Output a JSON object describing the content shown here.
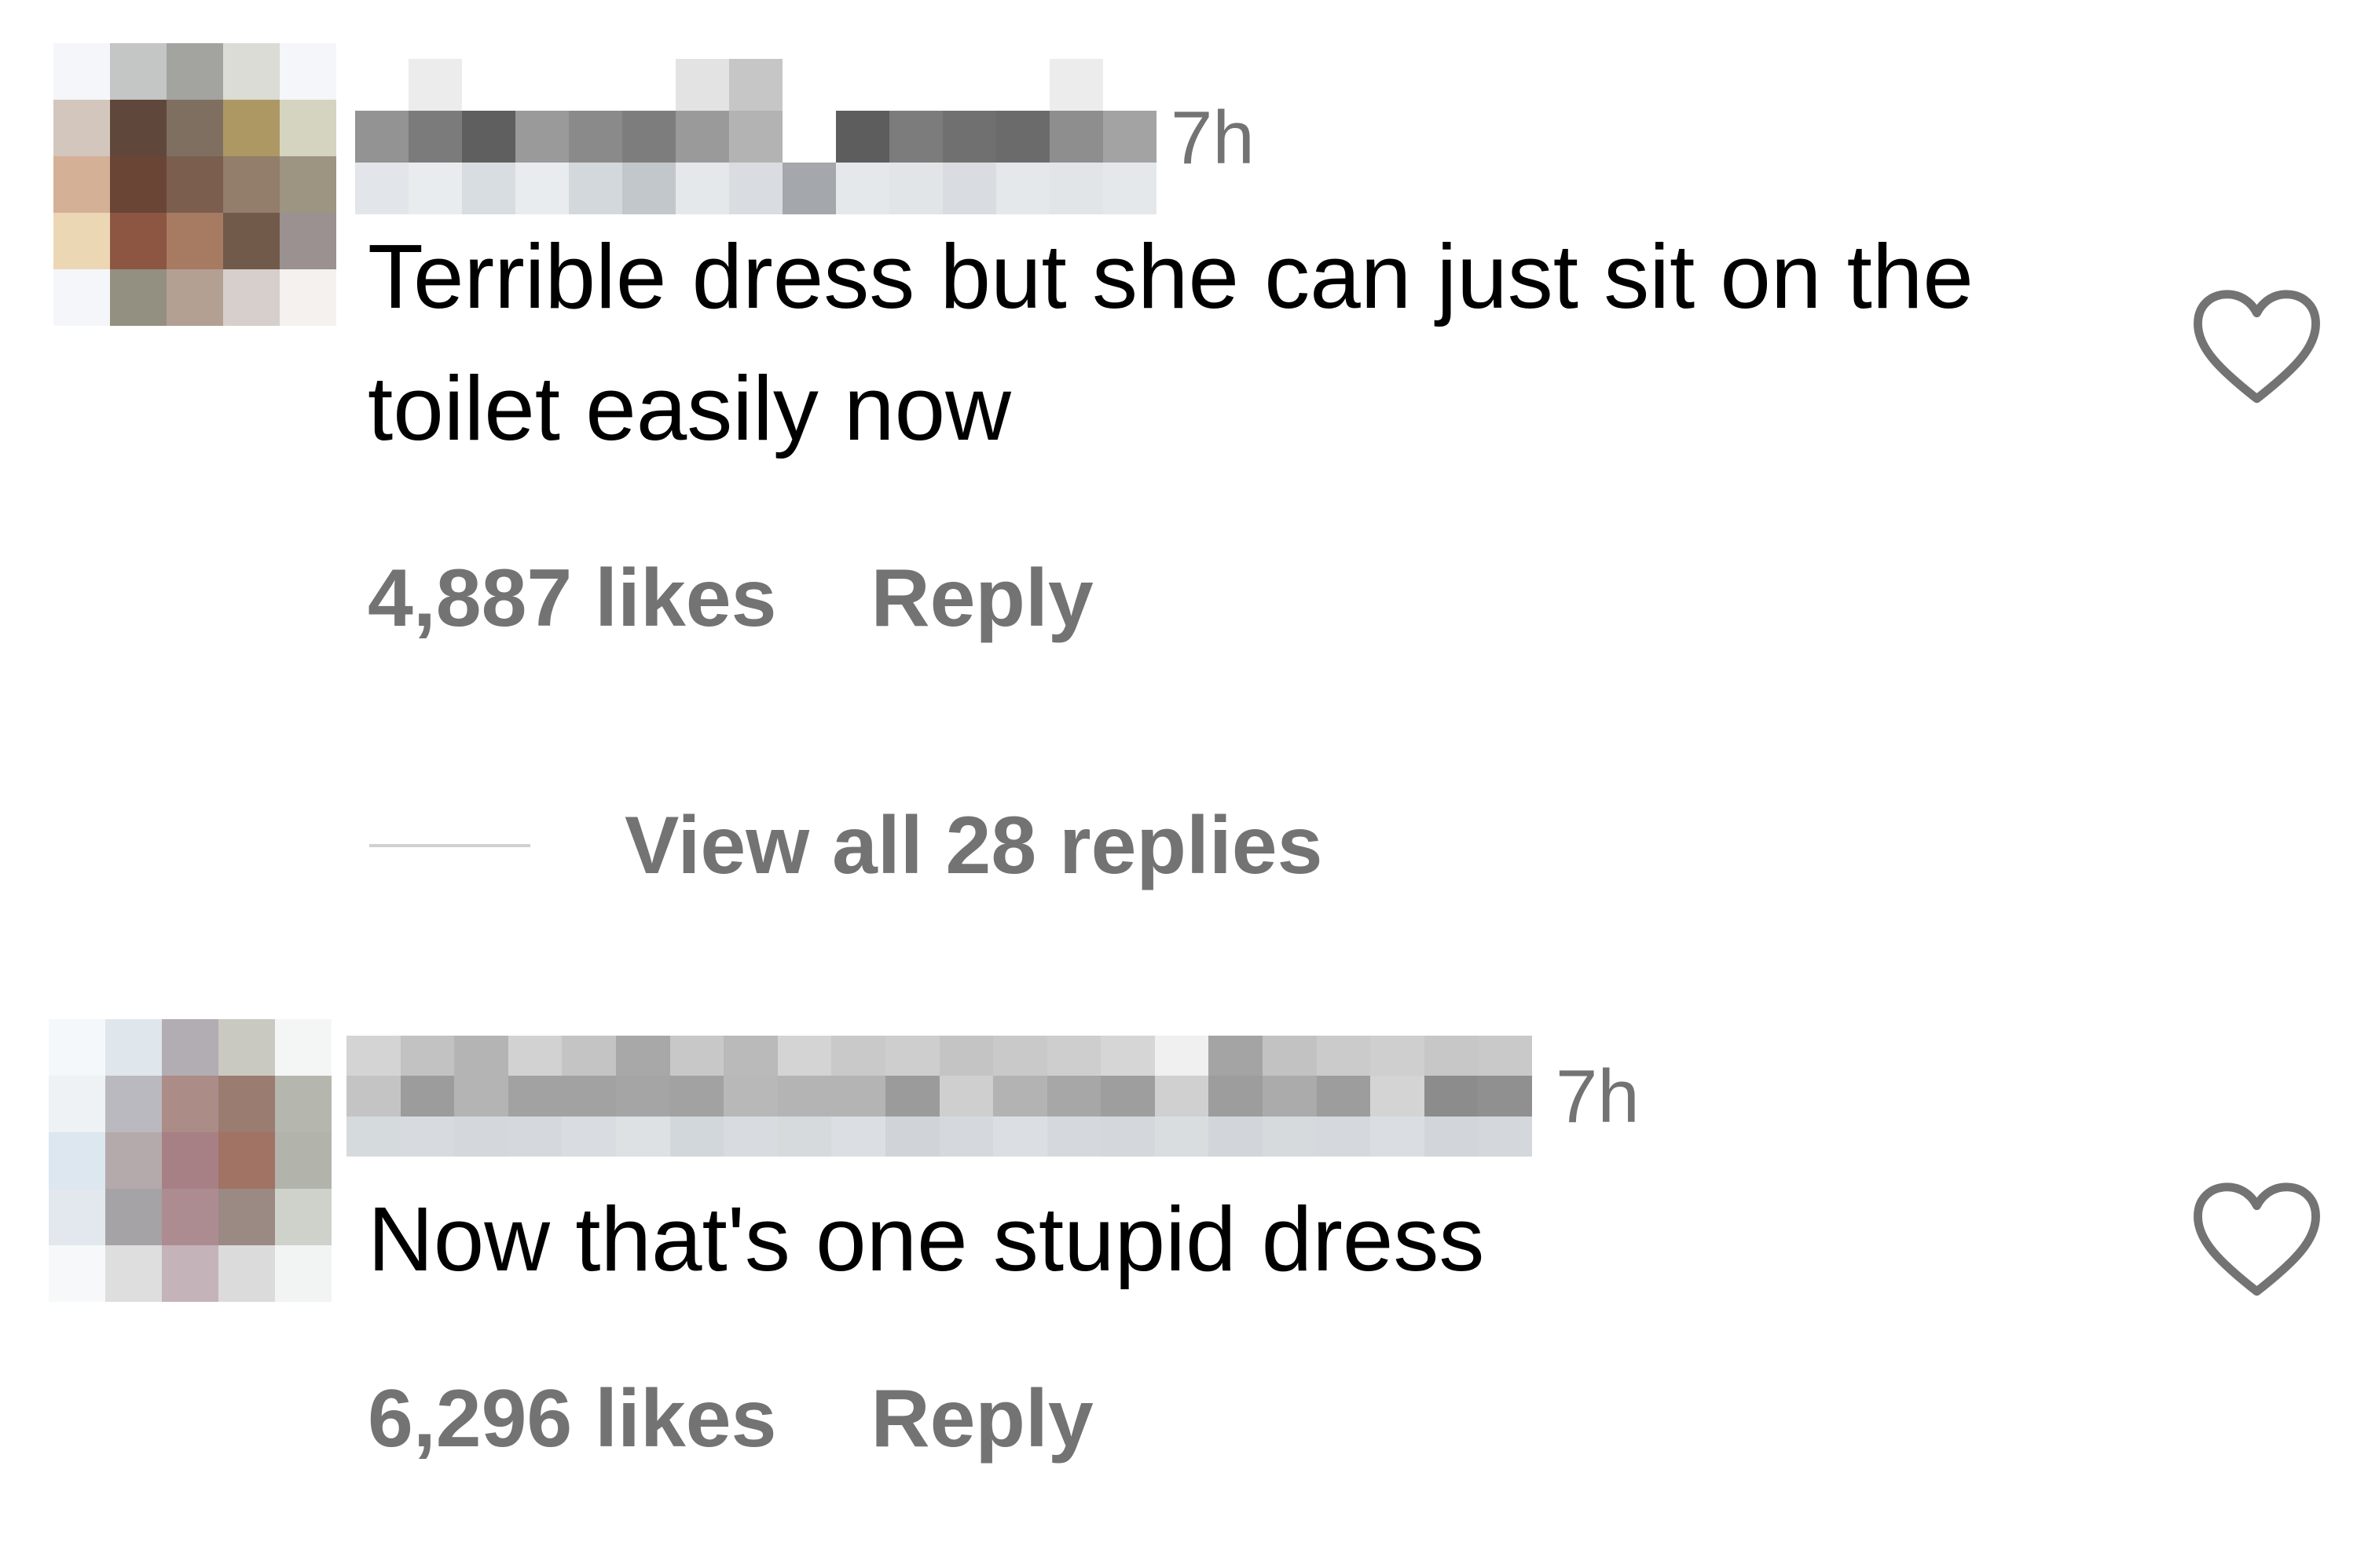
{
  "comments": [
    {
      "username_pixelated": true,
      "time": "7h",
      "text": "Terrible dress but she can just sit on the toilet easily now",
      "likes": "4,887 likes",
      "reply_label": "Reply",
      "liked": false,
      "avatar_colors": [
        "#f4f6fa",
        "#c4c5c5",
        "#a3a39f",
        "#dbdcd6",
        "#f4f6fa",
        "#d3c6bc",
        "#60473b",
        "#7f6f60",
        "#ad9863",
        "#d5d4c0",
        "#d4b097",
        "#6a4535",
        "#7b5e4e",
        "#927e6b",
        "#9d9481",
        "#ecd7b5",
        "#8c5642",
        "#a77a62",
        "#725a4b",
        "#9a9190",
        "#f5f6f9",
        "#939082",
        "#b3a092",
        "#d7cfcc",
        "#f4f1ee"
      ],
      "username_colors": [
        "#ffffff",
        "#ececec",
        "#ffffff",
        "#ffffff",
        "#ffffff",
        "#ffffff",
        "#e3e3e3",
        "#c6c6c6",
        "#ffffff",
        "#ffffff",
        "#ffffff",
        "#ffffff",
        "#ffffff",
        "#ececec",
        "#ffffff",
        "#939393",
        "#7b7b7b",
        "#5f5f5f",
        "#9a9a9a",
        "#8a8a8a",
        "#7d7d7d",
        "#9a9a9a",
        "#b3b3b3",
        "#ffffff",
        "#5d5d5d",
        "#7c7c7c",
        "#707070",
        "#6b6b6b",
        "#8e8e8e",
        "#a3a3a3",
        "#e2e6ea",
        "#e8ecef",
        "#d8dde1",
        "#e9ecef",
        "#d3d8dc",
        "#c2c7cb",
        "#e4e8eb",
        "#d9dde1",
        "#a4a8ac",
        "#e4e8eb",
        "#e1e5e8",
        "#d9dde1",
        "#e5e8eb",
        "#e1e5e8",
        "#e4e8eb"
      ]
    },
    {
      "username_pixelated": true,
      "time": "7h",
      "text": "Now that's one stupid dress",
      "likes": "6,296 likes",
      "reply_label": "Reply",
      "liked": false,
      "avatar_colors": [
        "#f4f8fa",
        "#dfe6ec",
        "#b1adb2",
        "#c9c9c1",
        "#f4f6f6",
        "#eef2f5",
        "#bbb9c0",
        "#ab8c87",
        "#9a7c70",
        "#b5b7ae",
        "#dce7ef",
        "#b5aaab",
        "#a78085",
        "#a07365",
        "#b2b3aa",
        "#e2e8ee",
        "#a6a3a6",
        "#ad8c91",
        "#9b8983",
        "#cfd2cb",
        "#f6f8fa",
        "#dedede",
        "#c4b3b8",
        "#dcdbdc",
        "#f2f4f4"
      ],
      "username_colors": [
        "#d4d4d4",
        "#c2c2c2",
        "#b4b4b4",
        "#d2d2d2",
        "#c4c4c4",
        "#a8a8a8",
        "#c8c8c8",
        "#bababa",
        "#d4d4d4",
        "#c9c9c9",
        "#cecece",
        "#c4c4c4",
        "#c9c9c9",
        "#cecece",
        "#d6d6d6",
        "#f0f0f0",
        "#a4a4a4",
        "#c2c2c2",
        "#cbcbcb",
        "#cfcfcf",
        "#c7c7c7",
        "#c9c9c9",
        "#c4c4c4",
        "#9c9c9c",
        "#b4b4b4",
        "#a2a2a2",
        "#a2a2a2",
        "#a5a5a5",
        "#a2a2a2",
        "#b8b8b8",
        "#b4b4b4",
        "#b4b4b4",
        "#9b9b9b",
        "#cfcfcf",
        "#b3b3b3",
        "#a7a7a7",
        "#9e9e9e",
        "#d0d0d0",
        "#9d9d9d",
        "#ababab",
        "#9d9d9d",
        "#d4d4d4",
        "#8c8c8c",
        "#909090",
        "#d5dadd",
        "#d7dbe0",
        "#d4d8dc",
        "#d5d9dd",
        "#d9dde1",
        "#dde1e4",
        "#d2d7dc",
        "#d8dce0",
        "#d6dadd",
        "#dbdfe3",
        "#d0d4d8",
        "#d5d9dd",
        "#dbdfe3",
        "#d5d9dd",
        "#d4d8dc",
        "#d9dde0",
        "#d2d6da",
        "#d6dadd",
        "#d5d9dd",
        "#dadee2",
        "#d2d6da",
        "#d4d8dc"
      ]
    }
  ],
  "view_replies": {
    "label": "View all 28 replies"
  },
  "colors": {
    "meta_gray": "#737373",
    "line_gray": "#d0d0d0",
    "heart_stroke": "#737373"
  }
}
